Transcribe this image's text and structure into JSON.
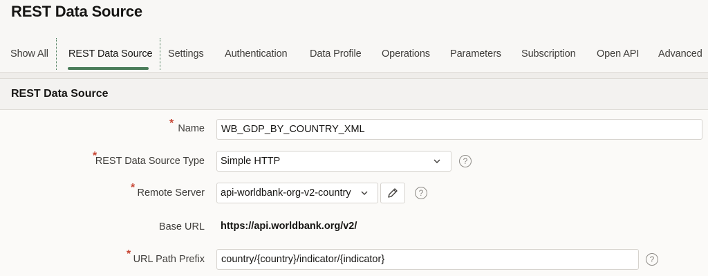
{
  "page": {
    "title": "REST Data Source"
  },
  "tabs": [
    {
      "label": "Show All",
      "active": false
    },
    {
      "label": "REST Data Source",
      "active": true
    },
    {
      "label": "Settings",
      "active": false
    },
    {
      "label": "Authentication",
      "active": false
    },
    {
      "label": "Data Profile",
      "active": false
    },
    {
      "label": "Operations",
      "active": false
    },
    {
      "label": "Parameters",
      "active": false
    },
    {
      "label": "Subscription",
      "active": false
    },
    {
      "label": "Open API",
      "active": false
    },
    {
      "label": "Advanced",
      "active": false
    }
  ],
  "region": {
    "title": "REST Data Source",
    "fields": {
      "name": {
        "label": "Name",
        "required": "*",
        "value": "WB_GDP_BY_COUNTRY_XML"
      },
      "type": {
        "label": "REST Data Source Type",
        "required": "*",
        "value": "Simple HTTP",
        "help": "?"
      },
      "remote_server": {
        "label": "Remote Server",
        "required": "*",
        "value": "api-worldbank-org-v2-country",
        "help": "?"
      },
      "base_url": {
        "label": "Base URL",
        "value": "https://api.worldbank.org/v2/"
      },
      "url_path_prefix": {
        "label": "URL Path Prefix",
        "required": "*",
        "value": "country/{country}/indicator/{indicator}",
        "help": "?"
      }
    }
  },
  "colors": {
    "accent": "#4a7c59",
    "required": "#c74634",
    "background": "#f8f7f5"
  },
  "icons": {
    "dropdown": "chevron-down-icon",
    "edit": "pencil-icon",
    "help": "help-circle-icon"
  }
}
